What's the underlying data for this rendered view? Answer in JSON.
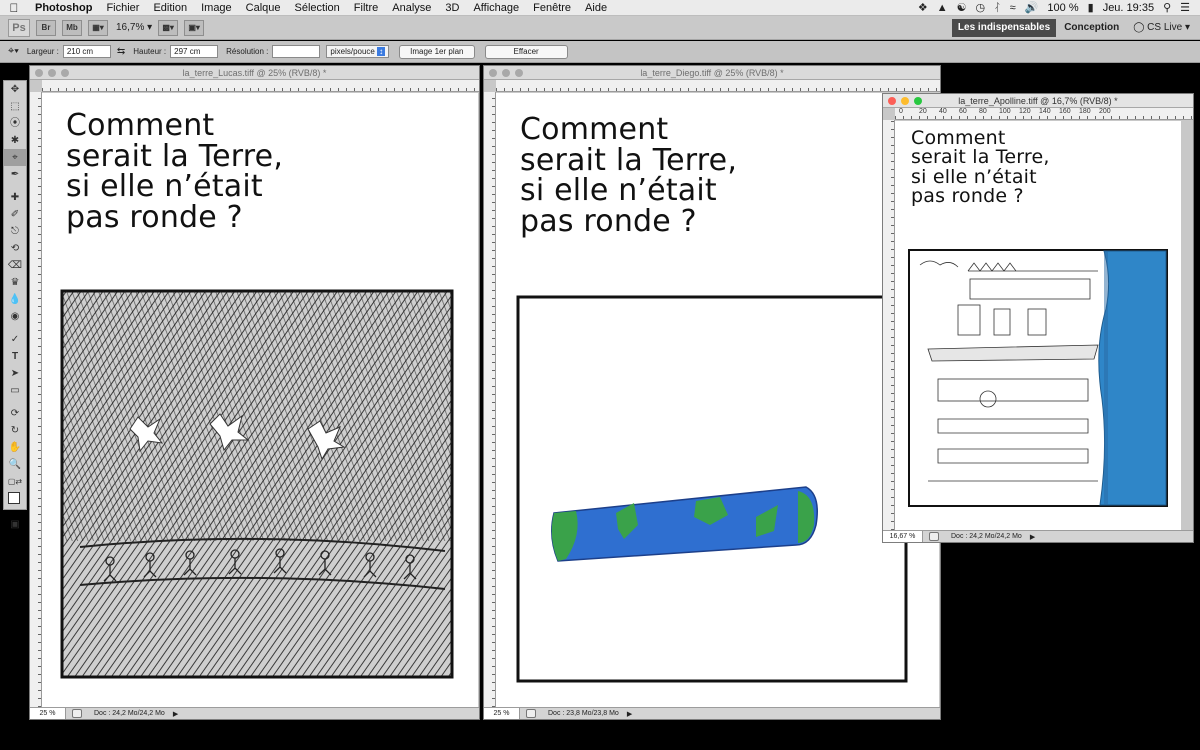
{
  "menubar": {
    "apple": "",
    "app": "Photoshop",
    "items": [
      "Fichier",
      "Edition",
      "Image",
      "Calque",
      "Sélection",
      "Filtre",
      "Analyse",
      "3D",
      "Affichage",
      "Fenêtre",
      "Aide"
    ],
    "battery": "100 %",
    "clock": "Jeu. 19:35"
  },
  "appbar": {
    "logo": "Ps",
    "chip_br": "Br",
    "chip_mb": "Mb",
    "zoom": "16,7%",
    "workspace_active": "Les indispensables",
    "workspace_other": "Conception",
    "cs_live": "CS Live"
  },
  "options": {
    "width_label": "Largeur :",
    "width_value": "210 cm",
    "height_label": "Hauteur :",
    "height_value": "297 cm",
    "resolution_label": "Résolution :",
    "resolution_value": "",
    "unit": "pixels/pouce",
    "front_image": "Image 1er plan",
    "clear": "Effacer"
  },
  "documents": [
    {
      "title": "la_terre_Lucas.tiff @ 25% (RVB/8) *",
      "heading": [
        "Comment",
        "serait la Terre,",
        "si elle n’était",
        "pas ronde ?"
      ],
      "zoom": "25 %",
      "doc_info": "Doc : 24,2 Mo/24,2 Mo"
    },
    {
      "title": "la_terre_Diego.tiff @ 25% (RVB/8) *",
      "heading": [
        "Comment",
        "serait la Terre,",
        "si elle n’était",
        "pas ronde ?"
      ],
      "zoom": "25 %",
      "doc_info": "Doc : 23,8 Mo/23,8 Mo"
    },
    {
      "title": "la_terre_Apolline.tiff @ 16,7% (RVB/8) *",
      "heading": [
        "Comment",
        "serait la Terre,",
        "si elle n’était",
        "pas ronde ?"
      ],
      "zoom": "16,67 %",
      "doc_info": "Doc : 24,2 Mo/24,2 Mo"
    }
  ],
  "ruler_numbers": [
    "0",
    "20",
    "40",
    "60",
    "80",
    "100",
    "120",
    "140",
    "160",
    "180",
    "200"
  ],
  "colors": {
    "menubar": "#ebebeb",
    "workspace_active": "#4a4a4a",
    "drawing_blue": "#2f6fd0",
    "drawing_green": "#3aa24a"
  }
}
